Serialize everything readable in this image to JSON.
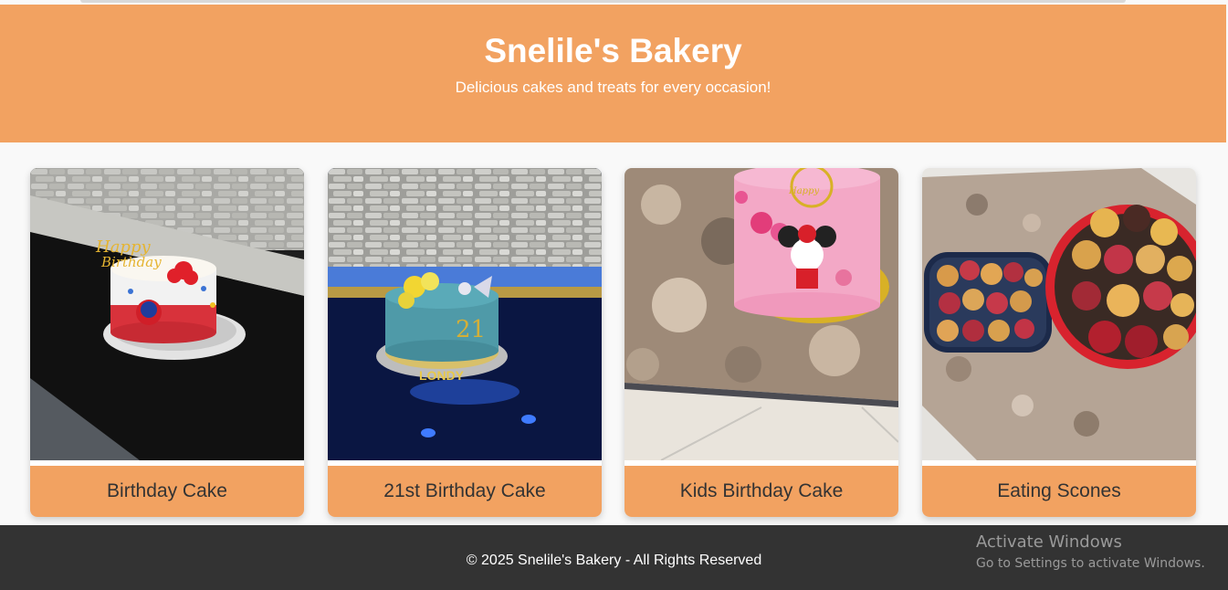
{
  "header": {
    "title": "Snelile's Bakery",
    "tagline": "Delicious cakes and treats for every occasion!"
  },
  "gallery": {
    "items": [
      {
        "caption": "Birthday Cake"
      },
      {
        "caption": "21st Birthday Cake"
      },
      {
        "caption": "Kids Birthday Cake"
      },
      {
        "caption": "Eating Scones"
      }
    ]
  },
  "footer": {
    "copyright": "© 2025 Snelile's Bakery - All Rights Reserved"
  },
  "watermark": {
    "title": "Activate Windows",
    "subtitle": "Go to Settings to activate Windows."
  },
  "colors": {
    "brand": "#f2a261",
    "footer_bg": "#333333",
    "caption_text": "#333333"
  }
}
